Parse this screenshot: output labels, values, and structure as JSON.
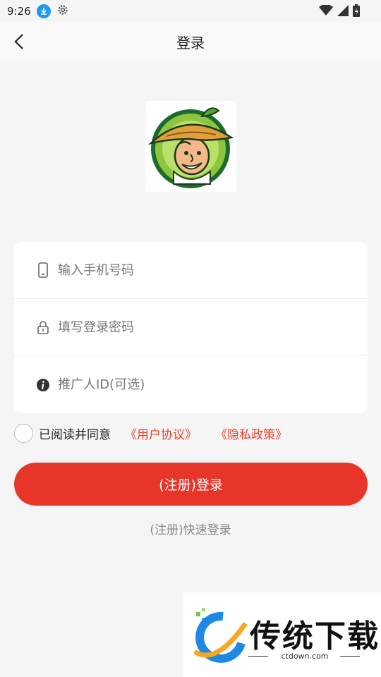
{
  "status_bar": {
    "time": "9:26"
  },
  "header": {
    "title": "登录"
  },
  "form": {
    "phone_placeholder": "输入手机号码",
    "password_placeholder": "填写登录密码",
    "promoter_placeholder": "推广人ID(可选)"
  },
  "agreement": {
    "text": "已阅读并同意",
    "user_agreement": "《用户协议》",
    "privacy_policy": "《隐私政策》"
  },
  "buttons": {
    "login": "(注册)登录",
    "quick_login": "(注册)快速登录"
  },
  "watermark": {
    "brand": "传统下载",
    "site": "ctdown.com"
  },
  "colors": {
    "accent": "#e8352a",
    "link": "#e8412a",
    "background": "#f5f5f5"
  }
}
